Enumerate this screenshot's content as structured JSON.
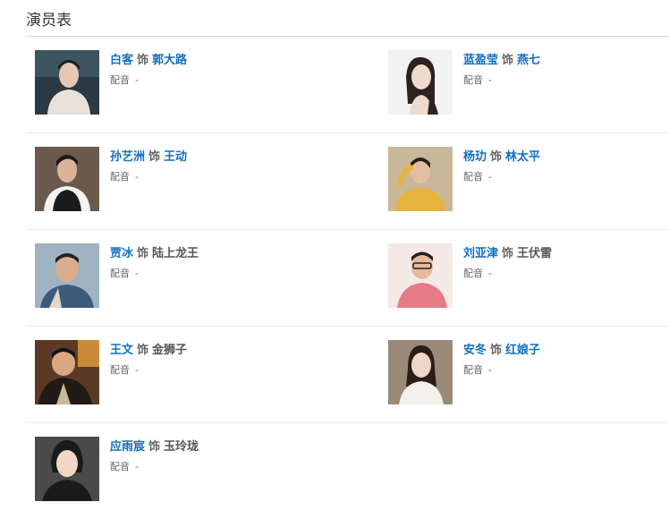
{
  "section": {
    "title": "演员表"
  },
  "cast": [
    {
      "actor": "白客",
      "connector": "饰",
      "role": "郭大路",
      "role_linked": true,
      "dub_label": "配音",
      "dub_value": "-",
      "photo_bg": "#2b3a44",
      "photo_fg": "#e8e2da"
    },
    {
      "actor": "蓝盈莹",
      "connector": "饰",
      "role": "燕七",
      "role_linked": true,
      "dub_label": "配音",
      "dub_value": "-",
      "photo_bg": "#f2f2f2",
      "photo_fg": "#2a2320"
    },
    {
      "actor": "孙艺洲",
      "connector": "饰",
      "role": "王动",
      "role_linked": true,
      "dub_label": "配音",
      "dub_value": "-",
      "photo_bg": "#6b5a4c",
      "photo_fg": "#1c1c1c"
    },
    {
      "actor": "杨玏",
      "connector": "饰",
      "role": "林太平",
      "role_linked": true,
      "dub_label": "配音",
      "dub_value": "-",
      "photo_bg": "#c9b79a",
      "photo_fg": "#e6b43c"
    },
    {
      "actor": "贾冰",
      "connector": "饰",
      "role": "陆上龙王",
      "role_linked": false,
      "dub_label": "配音",
      "dub_value": "-",
      "photo_bg": "#9fb3c2",
      "photo_fg": "#3c5a7a"
    },
    {
      "actor": "刘亚津",
      "connector": "饰",
      "role": "王伏雷",
      "role_linked": false,
      "dub_label": "配音",
      "dub_value": "-",
      "photo_bg": "#f4e9e6",
      "photo_fg": "#e77b86"
    },
    {
      "actor": "王文",
      "connector": "饰",
      "role": "金狮子",
      "role_linked": false,
      "dub_label": "配音",
      "dub_value": "-",
      "photo_bg": "#5a3a24",
      "photo_fg": "#221a14"
    },
    {
      "actor": "安冬",
      "connector": "饰",
      "role": "红娘子",
      "role_linked": true,
      "dub_label": "配音",
      "dub_value": "-",
      "photo_bg": "#9a8a78",
      "photo_fg": "#f3f1ec"
    },
    {
      "actor": "应雨宸",
      "connector": "饰",
      "role": "玉玲珑",
      "role_linked": false,
      "dub_label": "配音",
      "dub_value": "-",
      "photo_bg": "#4a4a4a",
      "photo_fg": "#1a1a1a"
    }
  ]
}
